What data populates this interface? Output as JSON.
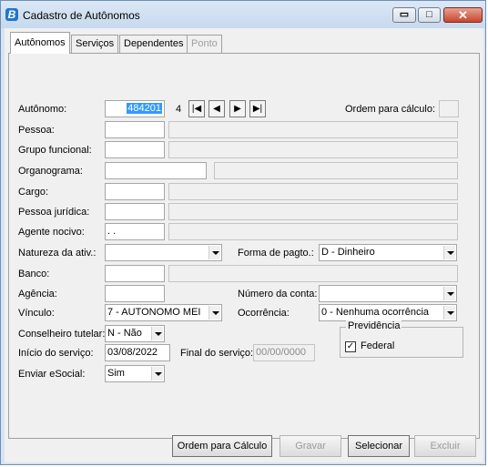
{
  "window": {
    "title": "Cadastro de Autônomos",
    "app_icon_letter": "B",
    "controls": {
      "minimize": "▭",
      "maximize": "□",
      "close": "✕"
    }
  },
  "tabs": [
    {
      "label": "Autônomos",
      "active": true
    },
    {
      "label": "Serviços"
    },
    {
      "label": "Dependentes"
    },
    {
      "label": "Ponto",
      "disabled": true
    }
  ],
  "form": {
    "autonomo_label": "Autônomo:",
    "autonomo_value": "484201",
    "autonomo_digit": "4",
    "nav": {
      "first": "|◀",
      "prev": "◀",
      "next": "▶",
      "last": "▶|"
    },
    "ordem_calc_label": "Ordem para cálculo:",
    "ordem_calc_value": "",
    "pessoa_label": "Pessoa:",
    "grupo_label": "Grupo funcional:",
    "organograma_label": "Organograma:",
    "cargo_label": "Cargo:",
    "pj_label": "Pessoa jurídica:",
    "agente_label": "Agente nocivo:",
    "agente_value": ". .",
    "natureza_label": "Natureza da ativ.:",
    "natureza_value": "",
    "forma_pagto_label": "Forma de pagto.:",
    "forma_pagto_value": "D - Dinheiro",
    "banco_label": "Banco:",
    "agencia_label": "Agência:",
    "num_conta_label": "Número da conta:",
    "num_conta_value": "",
    "vinculo_label": "Vínculo:",
    "vinculo_value": "7 - AUTONOMO MEI",
    "ocorrencia_label": "Ocorrência:",
    "ocorrencia_value": "0 - Nenhuma ocorrência",
    "conselheiro_label": "Conselheiro tutelar:",
    "conselheiro_value": "N - Não",
    "previdencia_title": "Previdência",
    "federal_label": "Federal",
    "federal_checked": "✓",
    "inicio_label": "Início do serviço:",
    "inicio_value": "03/08/2022",
    "final_label": "Final do serviço:",
    "final_value": "00/00/0000",
    "esocial_label": "Enviar eSocial:",
    "esocial_value": "Sim"
  },
  "buttons": {
    "ordem": "Ordem para Cálculo",
    "gravar": "Gravar",
    "selecionar": "Selecionar",
    "excluir": "Excluir"
  }
}
